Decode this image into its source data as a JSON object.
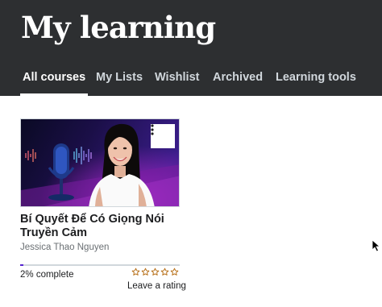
{
  "header": {
    "title": "My learning",
    "tabs": [
      {
        "label": "All courses",
        "active": true
      },
      {
        "label": "My Lists",
        "active": false
      },
      {
        "label": "Wishlist",
        "active": false
      },
      {
        "label": "Archived",
        "active": false
      },
      {
        "label": "Learning tools",
        "active": false
      }
    ]
  },
  "courses": [
    {
      "title": "Bí Quyết Để Có Giọng Nói Truyền Cảm",
      "instructor": "Jessica Thao Nguyen",
      "progress_percent": 2,
      "progress_label": "2% complete",
      "rating_stars": 0,
      "rating_max": 5,
      "rating_link": "Leave a rating",
      "menu_icon": "kebab-menu-icon"
    }
  ],
  "colors": {
    "header_bg": "#2d2f31",
    "progress_fill": "#5624d0",
    "star_outline": "#b4690e"
  }
}
